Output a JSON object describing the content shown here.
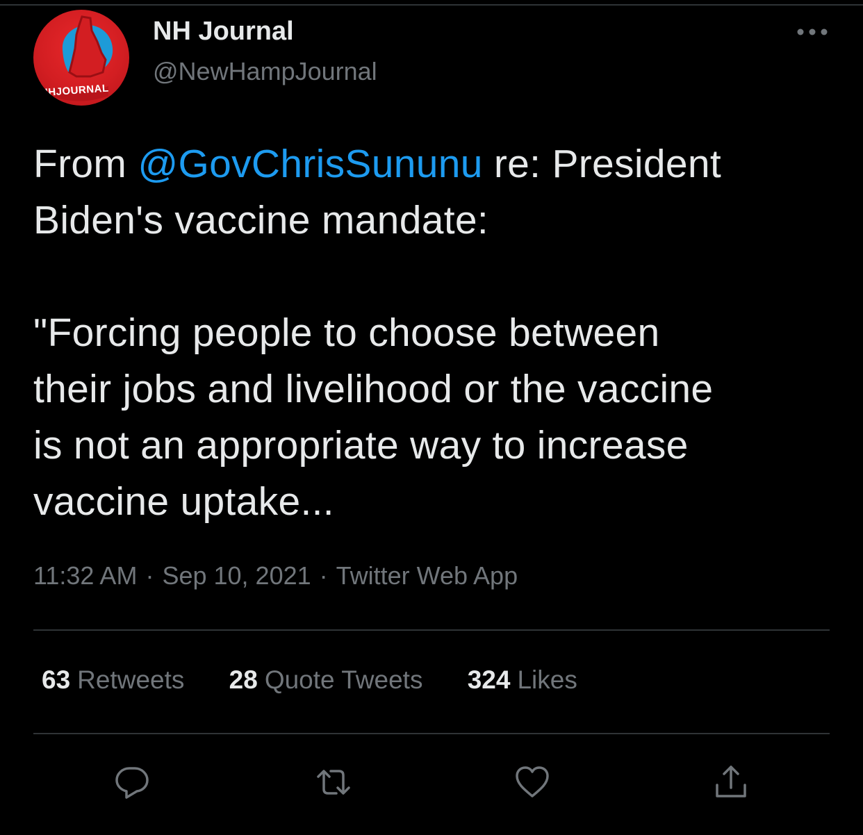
{
  "author": {
    "name": "NH Journal",
    "handle": "@NewHampJournal",
    "avatar_text": "NHJOURNAL"
  },
  "tweet": {
    "line1_prefix": "From ",
    "mention": "@GovChrisSununu",
    "line1_suffix": " re: President",
    "line2": "Biden's vaccine mandate:",
    "line3": "\"Forcing people to choose between",
    "line4": "their jobs and livelihood or the vaccine",
    "line5": "is not an appropriate way to increase",
    "line6": "vaccine uptake..."
  },
  "meta": {
    "time": "11:32 AM",
    "separator": "·",
    "date": "Sep 10, 2021",
    "source": "Twitter Web App"
  },
  "stats": {
    "retweets_count": "63",
    "retweets_label": "Retweets",
    "quotes_count": "28",
    "quotes_label": "Quote Tweets",
    "likes_count": "324",
    "likes_label": "Likes"
  },
  "actions": {
    "reply": "reply-icon",
    "retweet": "retweet-icon",
    "like": "heart-icon",
    "share": "share-icon"
  },
  "colors": {
    "background": "#000000",
    "text": "#e7e9ea",
    "secondary": "#71767b",
    "mention": "#1d9bf0",
    "divider": "#2f3336",
    "avatar_red": "#d31e22",
    "avatar_blue": "#1d9bd8"
  }
}
